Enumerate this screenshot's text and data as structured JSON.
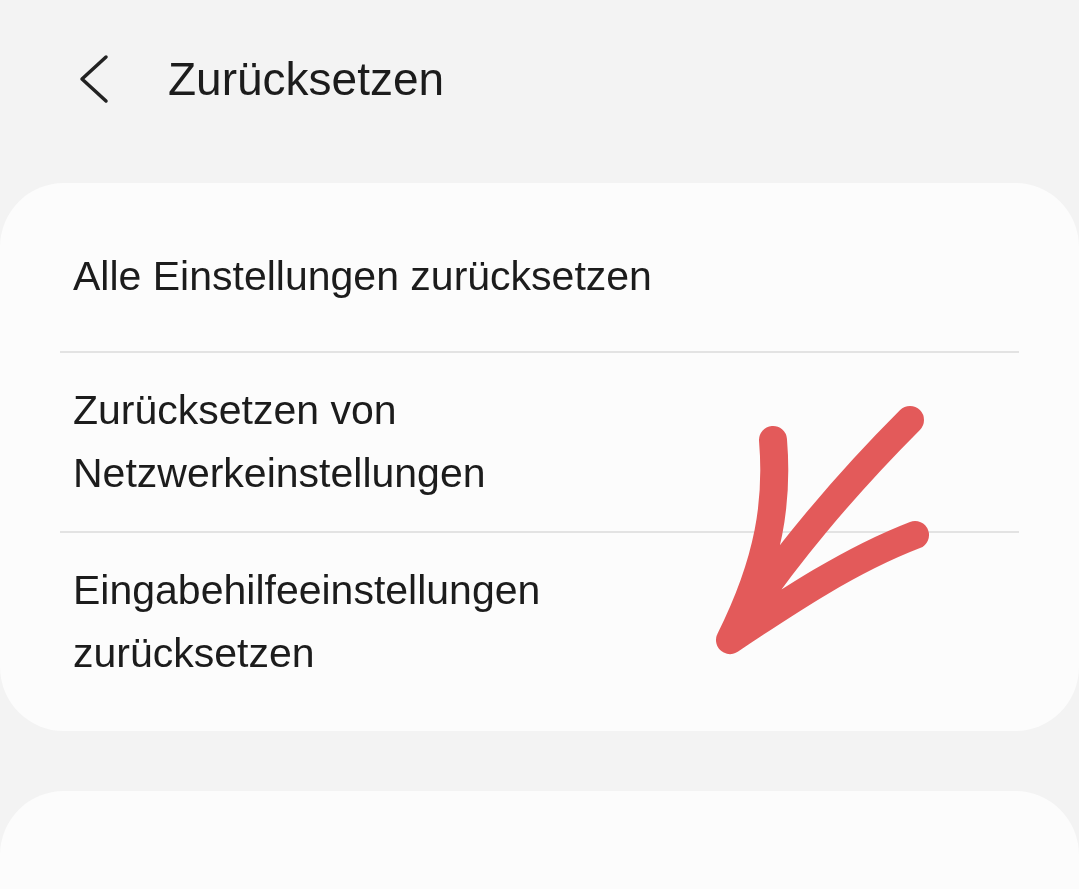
{
  "header": {
    "title": "Zurücksetzen"
  },
  "items": [
    {
      "label": "Alle Einstellungen zurücksetzen"
    },
    {
      "label": "Zurücksetzen von Netzwerkeinstellungen"
    },
    {
      "label": "Eingabehilfeeinstellungen zurücksetzen"
    }
  ]
}
